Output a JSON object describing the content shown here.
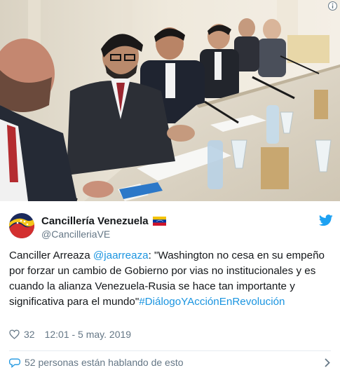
{
  "tweet": {
    "author_name": "Cancillería Venezuela",
    "author_handle": "@CancilleriaVE",
    "text_prefix": "Canciller Arreaza ",
    "mention": "@jaarreaza",
    "text_body": ": \"Washington no cesa en su empeño por forzar un cambio de Gobierno por vias no institucionales y es cuando la alianza Venezuela-Rusia se hace tan importante y significativa para el mundo\"",
    "hashtag": "#DiálogoYAcciónEnRevolución",
    "likes": "32",
    "timestamp": "12:01 - 5 may. 2019",
    "footer_text": "52 personas están hablando de esto"
  },
  "icons": {
    "info": "info-icon",
    "twitter_bird": "twitter-bird-icon",
    "heart": "heart-icon",
    "conversation": "chat-bubble-icon",
    "chevron": "chevron-right-icon",
    "flag": "venezuela-flag-icon"
  },
  "colors": {
    "link": "#1b95e0",
    "secondary_text": "#657786",
    "primary_text": "#14171a",
    "twitter_blue": "#1da1f2"
  }
}
